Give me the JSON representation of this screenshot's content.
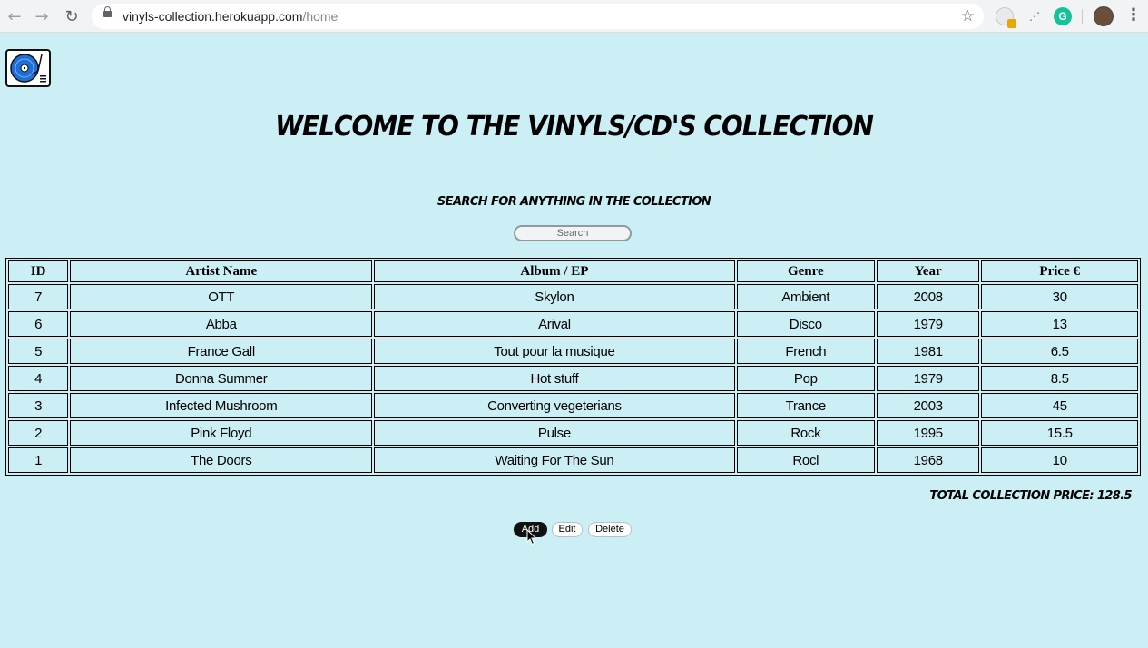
{
  "browser": {
    "url_host": "vinyls-collection.herokuapp.com",
    "url_path": "/home"
  },
  "page": {
    "title": "Welcome to the Vinyls/CD's Collection",
    "search_label": "Search for anything in the collection",
    "search_placeholder": "Search",
    "total_label": "Total Collection Price: 128.5"
  },
  "table": {
    "headers": [
      "ID",
      "Artist Name",
      "Album / EP",
      "Genre",
      "Year",
      "Price €"
    ],
    "rows": [
      [
        "7",
        "OTT",
        "Skylon",
        "Ambient",
        "2008",
        "30"
      ],
      [
        "6",
        "Abba",
        "Arival",
        "Disco",
        "1979",
        "13"
      ],
      [
        "5",
        "France Gall",
        "Tout pour la musique",
        "French",
        "1981",
        "6.5"
      ],
      [
        "4",
        "Donna Summer",
        "Hot stuff",
        "Pop",
        "1979",
        "8.5"
      ],
      [
        "3",
        "Infected Mushroom",
        "Converting vegeterians",
        "Trance",
        "2003",
        "45"
      ],
      [
        "2",
        "Pink Floyd",
        "Pulse",
        "Rock",
        "1995",
        "15.5"
      ],
      [
        "1",
        "The Doors",
        "Waiting For The Sun",
        "Rocl",
        "1968",
        "10"
      ]
    ]
  },
  "actions": {
    "add_label": "Add",
    "edit_label": "Edit",
    "delete_label": "Delete"
  },
  "colors": {
    "page_background": "#cbeff5",
    "logo_accent": "#1e6fd9"
  },
  "icons": [
    "back-arrow-icon",
    "forward-arrow-icon",
    "reload-icon",
    "lock-icon",
    "bookmark-star-icon",
    "turntable-logo-icon",
    "mouse-cursor-icon"
  ]
}
